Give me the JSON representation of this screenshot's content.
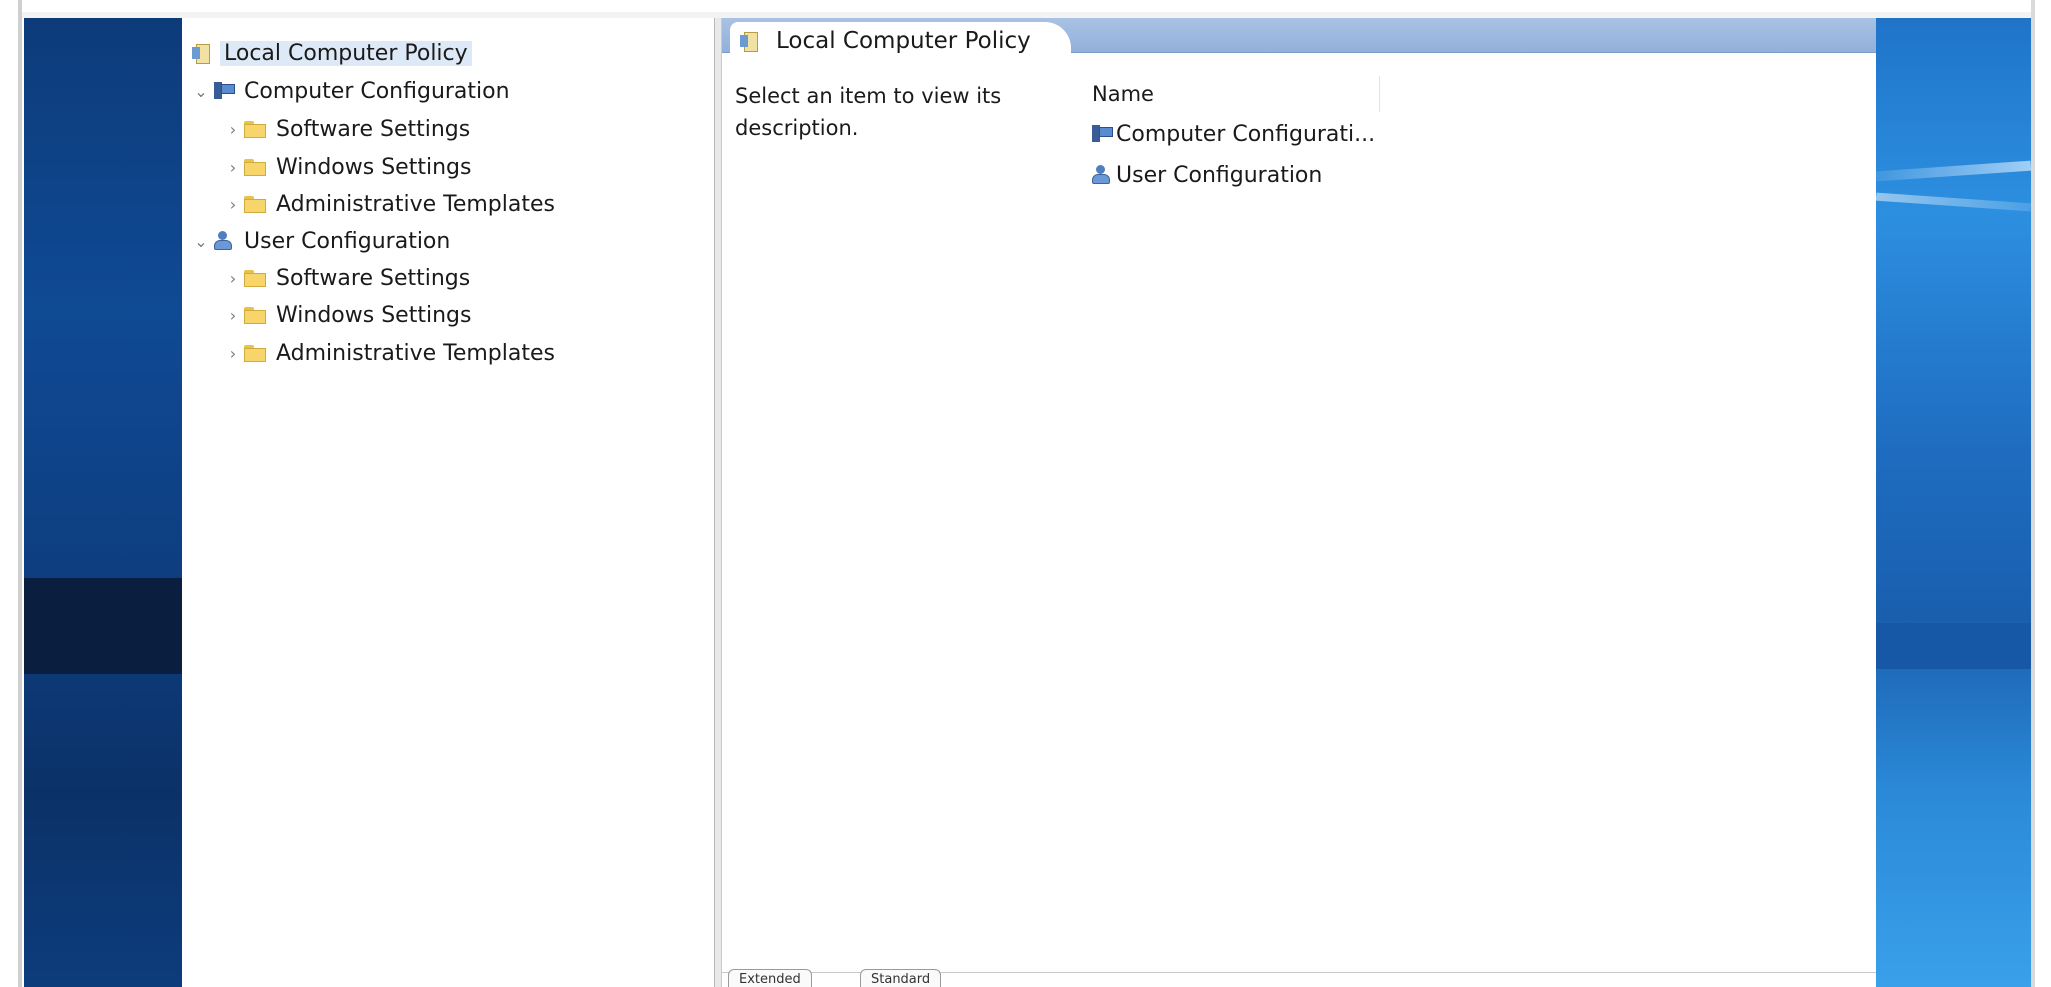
{
  "tree": {
    "root_label": "Local Computer Policy",
    "computer_configuration": {
      "label": "Computer Configuration",
      "children": [
        "Software Settings",
        "Windows Settings",
        "Administrative Templates"
      ]
    },
    "user_configuration": {
      "label": "User Configuration",
      "children": [
        "Software Settings",
        "Windows Settings",
        "Administrative Templates"
      ]
    }
  },
  "detail": {
    "header_title": "Local Computer Policy",
    "description": "Select an item to view its description.",
    "column_name": "Name",
    "items": [
      "Computer Configurati...",
      "User Configuration"
    ]
  },
  "bottom_tabs": {
    "extended": "Extended",
    "standard": "Standard"
  },
  "colors": {
    "header_bar": "#a9c2e4",
    "selection": "#dde9f7",
    "desktop_dark": "#0d3b7a",
    "desktop_light": "#2d8fe0"
  }
}
